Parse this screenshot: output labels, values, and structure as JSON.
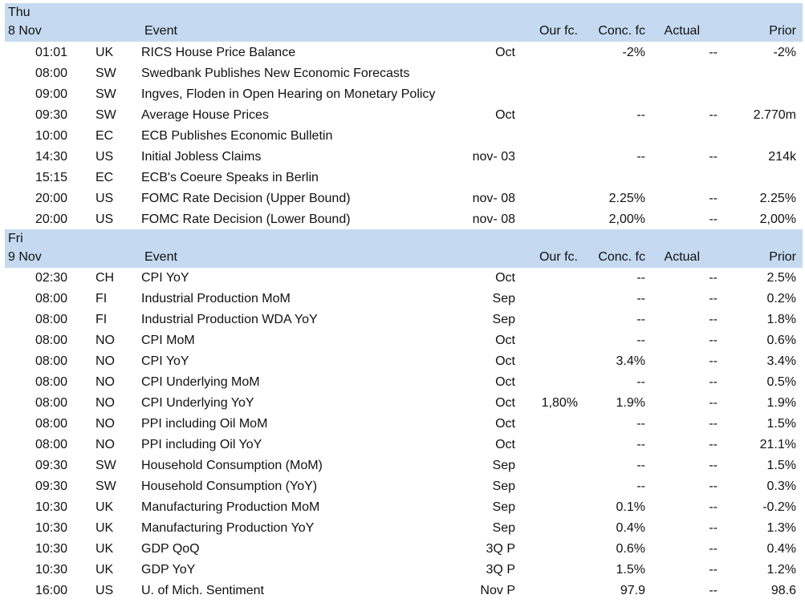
{
  "columns": {
    "event": "Event",
    "our_fc": "Our fc.",
    "conc_fc": "Conc. fc",
    "actual": "Actual",
    "prior": "Prior"
  },
  "days": [
    {
      "day": "Thu",
      "date": "8 Nov",
      "rows": [
        {
          "time": "01:01",
          "country": "UK",
          "event": "RICS House Price Balance",
          "period": "Oct",
          "our_fc": "",
          "conc_fc": "-2%",
          "actual": "--",
          "prior": "-2%"
        },
        {
          "time": "08:00",
          "country": "SW",
          "event": "Swedbank Publishes New Economic Forecasts",
          "period": "",
          "our_fc": "",
          "conc_fc": "",
          "actual": "",
          "prior": ""
        },
        {
          "time": "09:00",
          "country": "SW",
          "event": "Ingves, Floden in Open Hearing on Monetary Policy",
          "period": "",
          "our_fc": "",
          "conc_fc": "",
          "actual": "",
          "prior": ""
        },
        {
          "time": "09:30",
          "country": "SW",
          "event": "Average House Prices",
          "period": "Oct",
          "our_fc": "",
          "conc_fc": "--",
          "actual": "--",
          "prior": "2.770m"
        },
        {
          "time": "10:00",
          "country": "EC",
          "event": "ECB Publishes Economic Bulletin",
          "period": "",
          "our_fc": "",
          "conc_fc": "",
          "actual": "",
          "prior": ""
        },
        {
          "time": "14:30",
          "country": "US",
          "event": "Initial Jobless Claims",
          "period": "nov- 03",
          "our_fc": "",
          "conc_fc": "--",
          "actual": "--",
          "prior": "214k"
        },
        {
          "time": "15:15",
          "country": "EC",
          "event": "ECB's Coeure Speaks in Berlin",
          "period": "",
          "our_fc": "",
          "conc_fc": "",
          "actual": "",
          "prior": ""
        },
        {
          "time": "20:00",
          "country": "US",
          "event": "FOMC Rate Decision (Upper Bound)",
          "period": "nov- 08",
          "our_fc": "",
          "conc_fc": "2.25%",
          "actual": "--",
          "prior": "2.25%"
        },
        {
          "time": "20:00",
          "country": "US",
          "event": "FOMC Rate Decision (Lower Bound)",
          "period": "nov- 08",
          "our_fc": "",
          "conc_fc": "2,00%",
          "actual": "--",
          "prior": "2,00%"
        }
      ]
    },
    {
      "day": "Fri",
      "date": "9 Nov",
      "rows": [
        {
          "time": "02:30",
          "country": "CH",
          "event": "CPI YoY",
          "period": "Oct",
          "our_fc": "",
          "conc_fc": "--",
          "actual": "--",
          "prior": "2.5%"
        },
        {
          "time": "08:00",
          "country": "FI",
          "event": "Industrial Production MoM",
          "period": "Sep",
          "our_fc": "",
          "conc_fc": "--",
          "actual": "--",
          "prior": "0.2%"
        },
        {
          "time": "08:00",
          "country": "FI",
          "event": "Industrial Production WDA YoY",
          "period": "Sep",
          "our_fc": "",
          "conc_fc": "--",
          "actual": "--",
          "prior": "1.8%"
        },
        {
          "time": "08:00",
          "country": "NO",
          "event": "CPI MoM",
          "period": "Oct",
          "our_fc": "",
          "conc_fc": "--",
          "actual": "--",
          "prior": "0.6%"
        },
        {
          "time": "08:00",
          "country": "NO",
          "event": "CPI YoY",
          "period": "Oct",
          "our_fc": "",
          "conc_fc": "3.4%",
          "actual": "--",
          "prior": "3.4%"
        },
        {
          "time": "08:00",
          "country": "NO",
          "event": "CPI Underlying MoM",
          "period": "Oct",
          "our_fc": "",
          "conc_fc": "--",
          "actual": "--",
          "prior": "0.5%"
        },
        {
          "time": "08:00",
          "country": "NO",
          "event": "CPI Underlying YoY",
          "period": "Oct",
          "our_fc": "1,80%",
          "conc_fc": "1.9%",
          "actual": "--",
          "prior": "1.9%"
        },
        {
          "time": "08:00",
          "country": "NO",
          "event": "PPI including Oil MoM",
          "period": "Oct",
          "our_fc": "",
          "conc_fc": "--",
          "actual": "--",
          "prior": "1.5%"
        },
        {
          "time": "08:00",
          "country": "NO",
          "event": "PPI including Oil YoY",
          "period": "Oct",
          "our_fc": "",
          "conc_fc": "--",
          "actual": "--",
          "prior": "21.1%"
        },
        {
          "time": "09:30",
          "country": "SW",
          "event": "Household Consumption (MoM)",
          "period": "Sep",
          "our_fc": "",
          "conc_fc": "--",
          "actual": "--",
          "prior": "1.5%"
        },
        {
          "time": "09:30",
          "country": "SW",
          "event": "Household Consumption (YoY)",
          "period": "Sep",
          "our_fc": "",
          "conc_fc": "--",
          "actual": "--",
          "prior": "0.3%"
        },
        {
          "time": "10:30",
          "country": "UK",
          "event": "Manufacturing Production MoM",
          "period": "Sep",
          "our_fc": "",
          "conc_fc": "0.1%",
          "actual": "--",
          "prior": "-0.2%"
        },
        {
          "time": "10:30",
          "country": "UK",
          "event": "Manufacturing Production YoY",
          "period": "Sep",
          "our_fc": "",
          "conc_fc": "0.4%",
          "actual": "--",
          "prior": "1.3%"
        },
        {
          "time": "10:30",
          "country": "UK",
          "event": "GDP QoQ",
          "period": "3Q P",
          "our_fc": "",
          "conc_fc": "0.6%",
          "actual": "--",
          "prior": "0.4%"
        },
        {
          "time": "10:30",
          "country": "UK",
          "event": "GDP YoY",
          "period": "3Q P",
          "our_fc": "",
          "conc_fc": "1.5%",
          "actual": "--",
          "prior": "1.2%"
        },
        {
          "time": "16:00",
          "country": "US",
          "event": "U. of Mich. Sentiment",
          "period": "Nov P",
          "our_fc": "",
          "conc_fc": "97.9",
          "actual": "--",
          "prior": "98.6"
        }
      ]
    }
  ]
}
